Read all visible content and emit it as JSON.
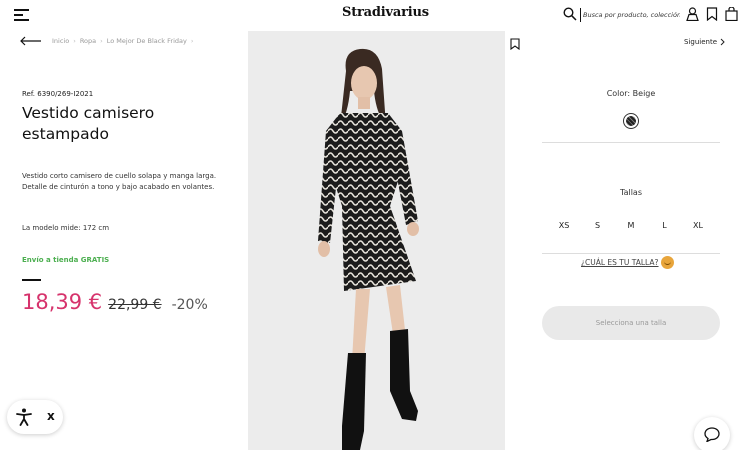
{
  "header": {
    "logo": "Stradivarius",
    "search_placeholder": "Busca por producto, colección..."
  },
  "breadcrumb": [
    "Inicio",
    "Ropa",
    "Lo Mejor De Black Friday"
  ],
  "product": {
    "ref": "Ref. 6390/269-I2021",
    "title": "Vestido camisero estampado",
    "description": "Vestido corto camisero de cuello solapa y manga larga. Detalle de cinturón a tono y bajo acabado en volantes.",
    "model_info": "La modelo mide: 172 cm",
    "shipping": "Envío a tienda GRATIS",
    "price": "18,39 €",
    "old_price": "22,99 €",
    "discount": "-20%"
  },
  "right_panel": {
    "next_label": "Siguiente",
    "color_label": "Color: Beige",
    "sizes_label": "Tallas",
    "sizes": [
      "XS",
      "S",
      "M",
      "L",
      "XL"
    ],
    "size_guide": "¿CUÁL ES TU TALLA?",
    "select_size": "Selecciona una talla"
  },
  "accessibility": {
    "close": "x"
  },
  "colors": {
    "price": "#d6336c",
    "shipping": "#4caf50",
    "button_bg": "#e9e9e9"
  }
}
